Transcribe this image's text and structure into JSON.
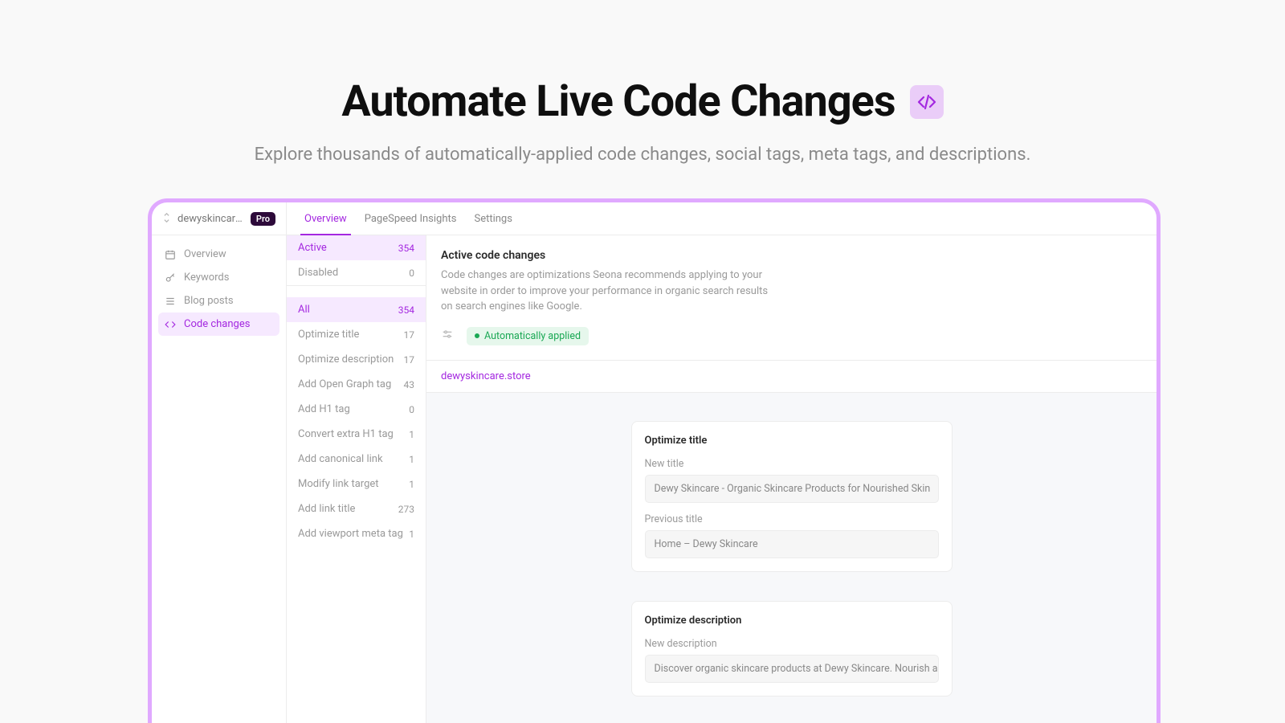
{
  "hero": {
    "title": "Automate Live Code Changes",
    "subtitle": "Explore thousands of automatically-applied code changes, social tags, meta tags, and descriptions."
  },
  "site": {
    "name": "dewyskincare.st…",
    "badge": "Pro"
  },
  "tabs": [
    {
      "label": "Overview",
      "active": true
    },
    {
      "label": "PageSpeed Insights",
      "active": false
    },
    {
      "label": "Settings",
      "active": false
    }
  ],
  "nav": [
    {
      "label": "Overview",
      "icon": "calendar",
      "active": false
    },
    {
      "label": "Keywords",
      "icon": "key",
      "active": false
    },
    {
      "label": "Blog posts",
      "icon": "list",
      "active": false
    },
    {
      "label": "Code changes",
      "icon": "code",
      "active": true
    }
  ],
  "statusFilters": [
    {
      "label": "Active",
      "count": 354,
      "highlight": true
    },
    {
      "label": "Disabled",
      "count": 0,
      "highlight": false
    }
  ],
  "categoryFilters": [
    {
      "label": "All",
      "count": 354,
      "highlight": true
    },
    {
      "label": "Optimize title",
      "count": 17
    },
    {
      "label": "Optimize description",
      "count": 17
    },
    {
      "label": "Add Open Graph tag",
      "count": 43
    },
    {
      "label": "Add H1 tag",
      "count": 0
    },
    {
      "label": "Convert extra H1 tag",
      "count": 1
    },
    {
      "label": "Add canonical link",
      "count": 1
    },
    {
      "label": "Modify link target",
      "count": 1
    },
    {
      "label": "Add link title",
      "count": 273
    },
    {
      "label": "Add viewport meta tag",
      "count": 1
    }
  ],
  "main": {
    "title": "Active code changes",
    "description": "Code changes are optimizations Seona recommends applying to your website in order to improve your performance in organic search results on search engines like Google.",
    "autoApplied": "Automatically applied",
    "url": "dewyskincare.store"
  },
  "cards": [
    {
      "title": "Optimize title",
      "fields": [
        {
          "label": "New title",
          "value": "Dewy Skincare - Organic Skincare Products for Nourished Skin"
        },
        {
          "label": "Previous title",
          "value": "Home – Dewy Skincare"
        }
      ]
    },
    {
      "title": "Optimize description",
      "fields": [
        {
          "label": "New description",
          "value": "Discover organic skincare products at Dewy Skincare. Nourish and hydrate yo"
        }
      ]
    }
  ]
}
